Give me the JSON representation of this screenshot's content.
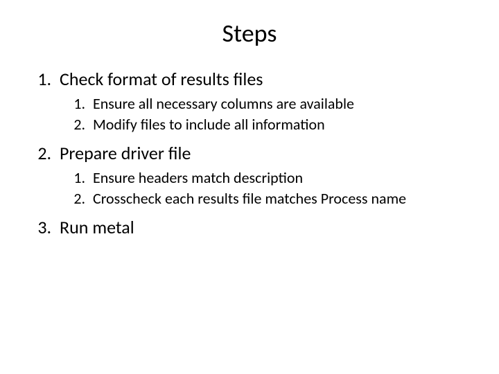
{
  "title": "Steps",
  "items": [
    {
      "text": "Check format of results files",
      "subitems": [
        {
          "text": "Ensure all necessary columns are available"
        },
        {
          "text": "Modify files to include all information"
        }
      ]
    },
    {
      "text": "Prepare driver file",
      "subitems": [
        {
          "text": "Ensure headers match description"
        },
        {
          "text": "Crosscheck each results file matches Process name"
        }
      ]
    },
    {
      "text": "Run metal",
      "subitems": []
    }
  ]
}
